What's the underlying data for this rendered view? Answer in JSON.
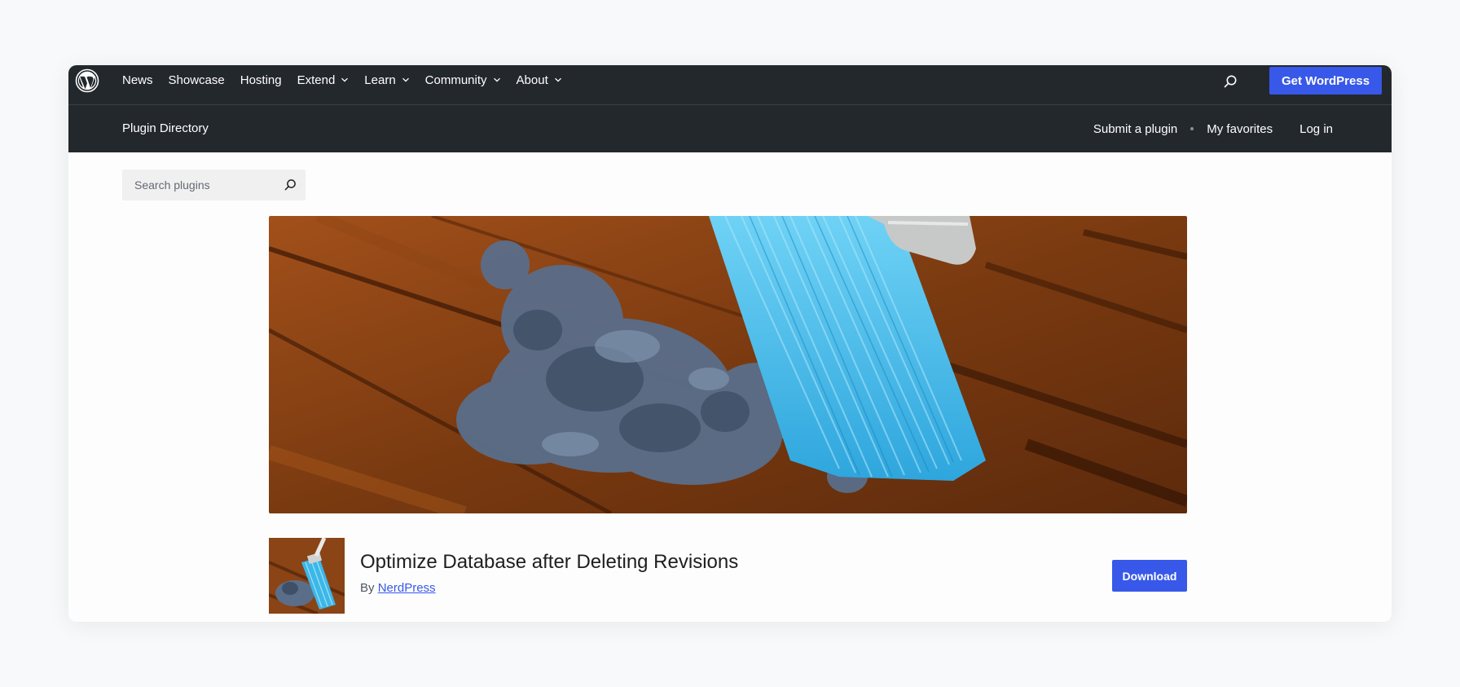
{
  "header": {
    "nav_items": [
      {
        "label": "News",
        "has_dropdown": false
      },
      {
        "label": "Showcase",
        "has_dropdown": false
      },
      {
        "label": "Hosting",
        "has_dropdown": false
      },
      {
        "label": "Extend",
        "has_dropdown": true
      },
      {
        "label": "Learn",
        "has_dropdown": true
      },
      {
        "label": "Community",
        "has_dropdown": true
      },
      {
        "label": "About",
        "has_dropdown": true
      }
    ],
    "get_wordpress_label": "Get WordPress",
    "icons": {
      "logo": "wordpress-logo-icon",
      "search": "search-icon",
      "dropdown": "chevron-down-icon"
    }
  },
  "local_nav": {
    "title": "Plugin Directory",
    "submit_label": "Submit a plugin",
    "favorites_label": "My favorites",
    "login_label": "Log in"
  },
  "search": {
    "placeholder": "Search plugins"
  },
  "plugin": {
    "title": "Optimize Database after Deleting Revisions",
    "by_label": "By",
    "author": "NerdPress",
    "download_label": "Download"
  },
  "colors": {
    "header_bg": "#23282d",
    "accent": "#3858e9",
    "page_bg": "#f8f9fa"
  }
}
